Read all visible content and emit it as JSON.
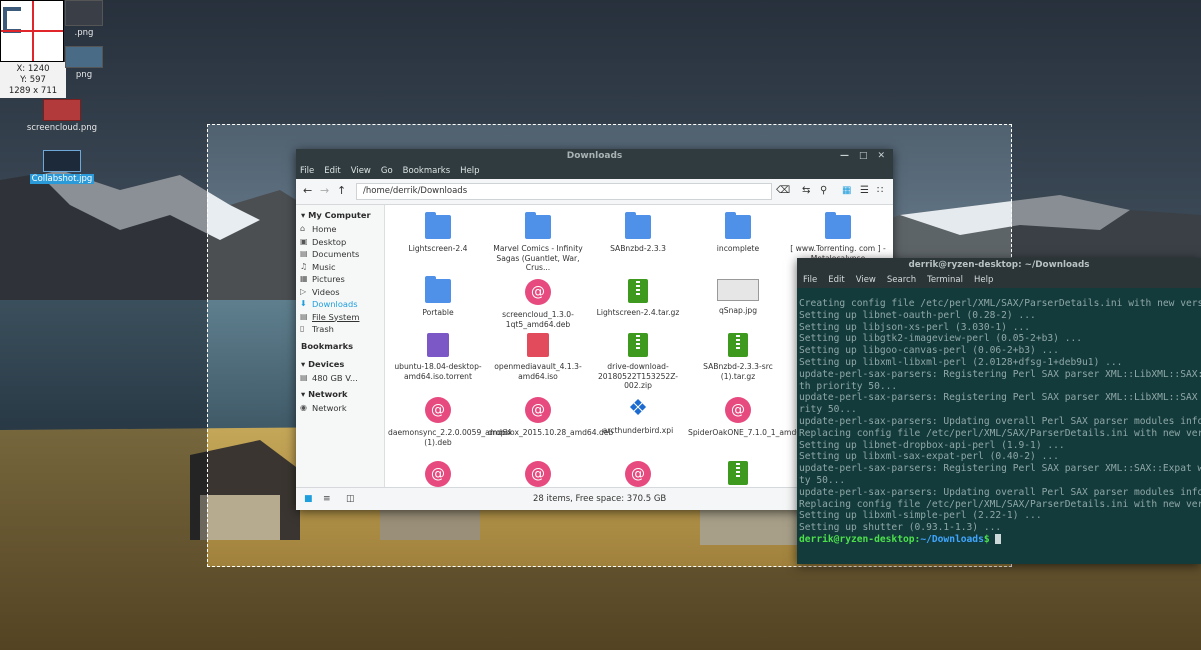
{
  "magnifier": {
    "x_label": "X: 1240",
    "y_label": "Y: 597",
    "size_label": "1289 x 711"
  },
  "desktop_icons": [
    {
      "label": ".png"
    },
    {
      "label": "png"
    },
    {
      "label": "screencloud.png"
    },
    {
      "label": "Collabshot.jpg"
    }
  ],
  "file_manager": {
    "title": "Downloads",
    "menu": [
      "File",
      "Edit",
      "View",
      "Go",
      "Bookmarks",
      "Help"
    ],
    "path": "/home/derrik/Downloads",
    "sidebar": {
      "my_computer": "My Computer",
      "places": [
        "Home",
        "Desktop",
        "Documents",
        "Music",
        "Pictures",
        "Videos",
        "Downloads",
        "File System",
        "Trash"
      ],
      "bookmarks": "Bookmarks",
      "devices": "Devices",
      "device_items": [
        "480 GB V..."
      ],
      "network": "Network",
      "network_items": [
        "Network"
      ]
    },
    "files": [
      {
        "name": "Lightscreen-2.4",
        "type": "folder"
      },
      {
        "name": "Marvel Comics - Infinity Sagas (Guantlet, War, Crus...",
        "type": "folder"
      },
      {
        "name": "SABnzbd-2.3.3",
        "type": "folder"
      },
      {
        "name": "incomplete",
        "type": "folder"
      },
      {
        "name": "[ www.Torrenting. com ] - Metalocalypse",
        "type": "folder"
      },
      {
        "name": "Portable",
        "type": "folder"
      },
      {
        "name": "screencloud_1.3.0-1qt5_amd64.deb",
        "type": "deb"
      },
      {
        "name": "Lightscreen-2.4.tar.gz",
        "type": "archive"
      },
      {
        "name": "qSnap.jpg",
        "type": "image"
      },
      {
        "name": "ubuntu-18.04-desktop-amd64.iso.torrent",
        "type": "torrent"
      },
      {
        "name": "openmediavault_4.1.3-amd64.iso",
        "type": "iso"
      },
      {
        "name": "drive-download-20180522T153252Z-002.zip",
        "type": "archive"
      },
      {
        "name": "SABnzbd-2.3.3-src (1).tar.gz",
        "type": "archive"
      },
      {
        "name": "daemonsync_2.2.0.0059_amd64 (1).deb",
        "type": "deb"
      },
      {
        "name": "dropbox_2015.10.28_amd64.deb",
        "type": "deb"
      },
      {
        "name": "arcthunderbird.xpi",
        "type": "puzzle"
      },
      {
        "name": "SpiderOakONE_7.1.0_1_amd64.deb",
        "type": "deb"
      },
      {
        "name": "",
        "type": "deb"
      },
      {
        "name": "",
        "type": "deb"
      },
      {
        "name": "",
        "type": "deb"
      },
      {
        "name": "",
        "type": "archive"
      }
    ],
    "status": "28 items, Free space: 370.5 GB"
  },
  "terminal": {
    "title": "derrik@ryzen-desktop: ~/Downloads",
    "menu": [
      "File",
      "Edit",
      "View",
      "Search",
      "Terminal",
      "Help"
    ],
    "lines": [
      "Creating config file /etc/perl/XML/SAX/ParserDetails.ini with new versi",
      "Setting up libnet-oauth-perl (0.28-2) ...",
      "Setting up libjson-xs-perl (3.030-1) ...",
      "Setting up libgtk2-imageview-perl (0.05-2+b3) ...",
      "Setting up libgoo-canvas-perl (0.06-2+b3) ...",
      "Setting up libxml-libxml-perl (2.0128+dfsg-1+deb9u1) ...",
      "update-perl-sax-parsers: Registering Perl SAX parser XML::LibXML::SAX::",
      "th priority 50...",
      "update-perl-sax-parsers: Registering Perl SAX parser XML::LibXML::SAX w",
      "rity 50...",
      "update-perl-sax-parsers: Updating overall Perl SAX parser modules info",
      "Replacing config file /etc/perl/XML/SAX/ParserDetails.ini with new vers",
      "Setting up libnet-dropbox-api-perl (1.9-1) ...",
      "Setting up libxml-sax-expat-perl (0.40-2) ...",
      "update-perl-sax-parsers: Registering Perl SAX parser XML::SAX::Expat wi",
      "ty 50...",
      "update-perl-sax-parsers: Updating overall Perl SAX parser modules info",
      "Replacing config file /etc/perl/XML/SAX/ParserDetails.ini with new vers",
      "Setting up libxml-simple-perl (2.22-1) ...",
      "Setting up shutter (0.93.1-1.3) ..."
    ],
    "prompt_user": "derrik@ryzen-desktop",
    "prompt_sep": ":",
    "prompt_path": "~/Downloads",
    "prompt_end": "$ "
  }
}
